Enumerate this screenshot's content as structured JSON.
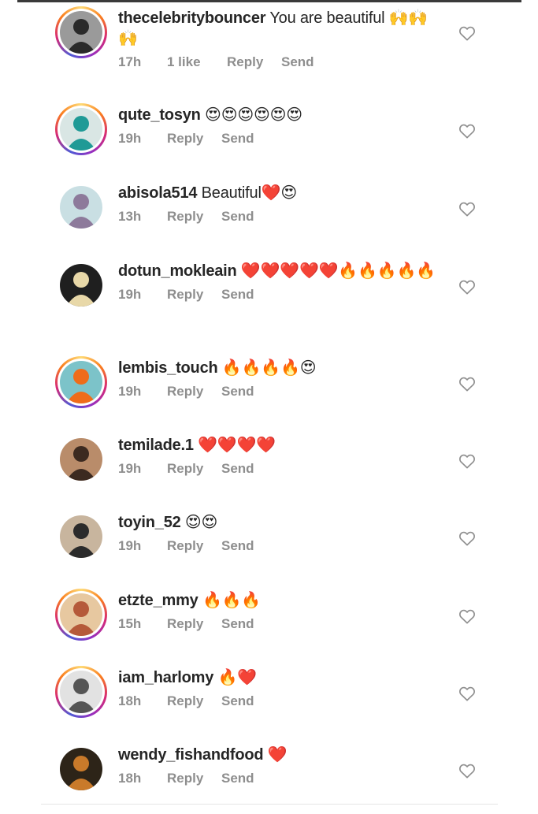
{
  "comments": [
    {
      "username": "thecelebritybouncer",
      "text": "You are beautiful 🙌🙌🙌",
      "time": "17h",
      "likes": "1 like",
      "reply": "Reply",
      "send": "Send",
      "story": true,
      "avatar_bg": "#9a9a9a",
      "avatar_fg": "#2a2a2a"
    },
    {
      "username": "qute_tosyn",
      "text": "😍😍😍😍😍😍",
      "time": "19h",
      "likes": "",
      "reply": "Reply",
      "send": "Send",
      "story": true,
      "avatar_bg": "#d9e6e4",
      "avatar_fg": "#1f9a96"
    },
    {
      "username": "abisola514",
      "text": "Beautiful❤️😍",
      "time": "13h",
      "likes": "",
      "reply": "Reply",
      "send": "Send",
      "story": false,
      "avatar_bg": "#c9dfe3",
      "avatar_fg": "#8d7a9b"
    },
    {
      "username": "dotun_mokleain",
      "text": "❤️❤️❤️❤️❤️🔥🔥🔥🔥🔥",
      "time": "19h",
      "likes": "",
      "reply": "Reply",
      "send": "Send",
      "story": false,
      "avatar_bg": "#1f1f1f",
      "avatar_fg": "#e8d8a8"
    },
    {
      "username": "lembis_touch",
      "text": "🔥🔥🔥🔥😍",
      "time": "19h",
      "likes": "",
      "reply": "Reply",
      "send": "Send",
      "story": true,
      "avatar_bg": "#7cc3c9",
      "avatar_fg": "#ef6c1a"
    },
    {
      "username": "temilade.1",
      "text": "❤️❤️❤️❤️",
      "time": "19h",
      "likes": "",
      "reply": "Reply",
      "send": "Send",
      "story": false,
      "avatar_bg": "#b98c6a",
      "avatar_fg": "#3c2a20"
    },
    {
      "username": "toyin_52",
      "text": "😍😍",
      "time": "19h",
      "likes": "",
      "reply": "Reply",
      "send": "Send",
      "story": false,
      "avatar_bg": "#c8b59e",
      "avatar_fg": "#2b2b2b"
    },
    {
      "username": "etzte_mmy",
      "text": "🔥🔥🔥",
      "time": "15h",
      "likes": "",
      "reply": "Reply",
      "send": "Send",
      "story": true,
      "avatar_bg": "#e7c8a0",
      "avatar_fg": "#b55a3a"
    },
    {
      "username": "iam_harlomy",
      "text": "🔥❤️",
      "time": "18h",
      "likes": "",
      "reply": "Reply",
      "send": "Send",
      "story": true,
      "avatar_bg": "#e2e2e2",
      "avatar_fg": "#555555"
    },
    {
      "username": "wendy_fishandfood",
      "text": "❤️",
      "time": "18h",
      "likes": "",
      "reply": "Reply",
      "send": "Send",
      "story": false,
      "avatar_bg": "#2d2418",
      "avatar_fg": "#c97a2a"
    }
  ],
  "colors": {
    "username": "#262626",
    "meta": "#8e8e8e",
    "heart_outline": "#8e8e8e"
  },
  "icons": {
    "like": "heart-outline-icon"
  }
}
